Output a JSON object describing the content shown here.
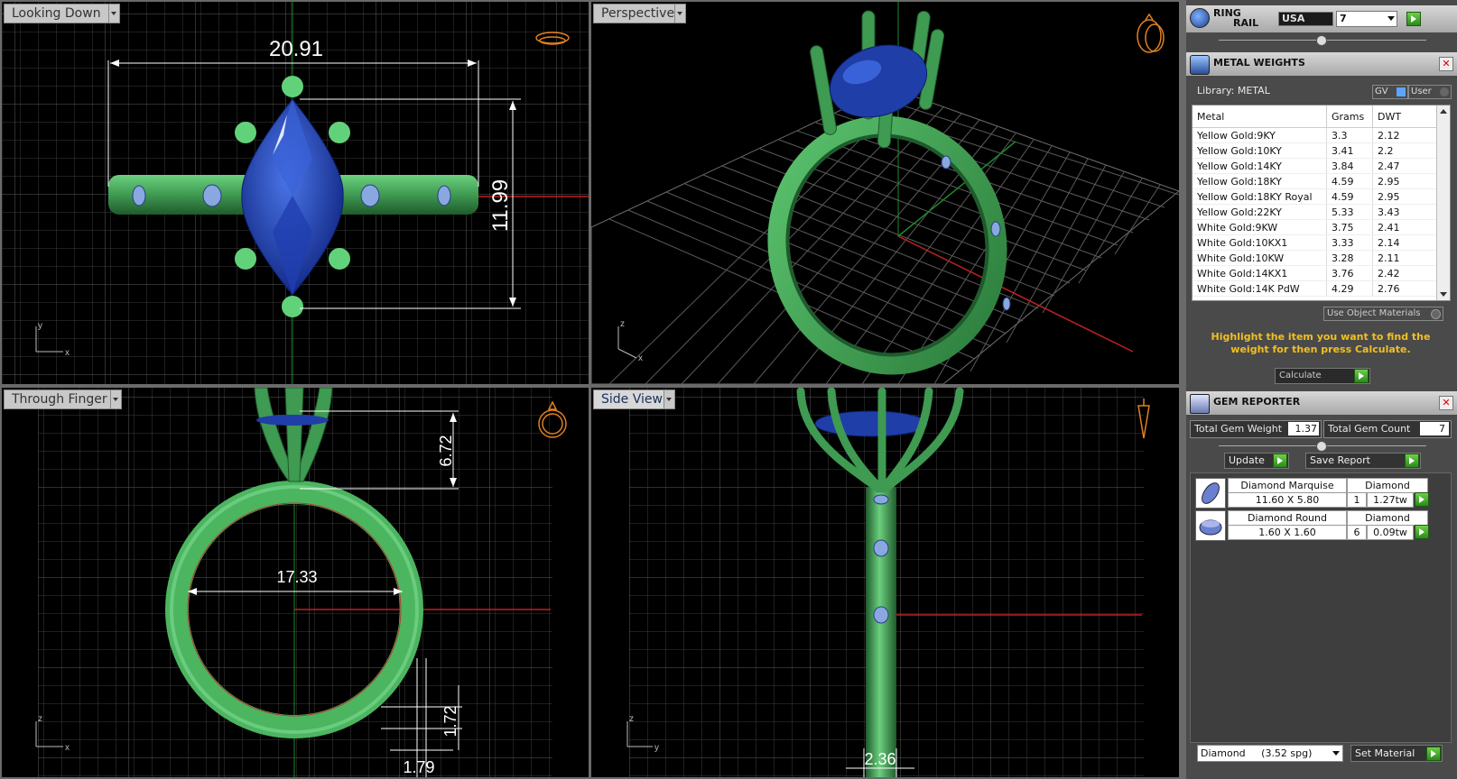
{
  "viewports": {
    "top": {
      "title": "Looking Down",
      "dim_width": "20.91",
      "dim_height": "11.99"
    },
    "perspective": {
      "title": "Perspective"
    },
    "front": {
      "title": "Through Finger",
      "dim_diameter": "17.33",
      "dim_prong_height": "6.72",
      "dim_band_thickness": "1.72",
      "dim_band_width": "1.79"
    },
    "side": {
      "title": "Side View",
      "dim_shank": "2.36"
    }
  },
  "ring_rail": {
    "title_line1": "RING",
    "title_line2": "RAIL",
    "size_system": "USA",
    "size_value": "7"
  },
  "metal_weights": {
    "title": "METAL WEIGHTS",
    "library_label": "Library: METAL",
    "gv_label": "GV",
    "user_label": "User",
    "columns": [
      "Metal",
      "Grams",
      "DWT"
    ],
    "rows": [
      [
        "Yellow Gold:9KY",
        "3.3",
        "2.12"
      ],
      [
        "Yellow Gold:10KY",
        "3.41",
        "2.2"
      ],
      [
        "Yellow Gold:14KY",
        "3.84",
        "2.47"
      ],
      [
        "Yellow Gold:18KY",
        "4.59",
        "2.95"
      ],
      [
        "Yellow Gold:18KY Royal",
        "4.59",
        "2.95"
      ],
      [
        "Yellow Gold:22KY",
        "5.33",
        "3.43"
      ],
      [
        "White Gold:9KW",
        "3.75",
        "2.41"
      ],
      [
        "White Gold:10KX1",
        "3.33",
        "2.14"
      ],
      [
        "White Gold:10KW",
        "3.28",
        "2.11"
      ],
      [
        "White Gold:14KX1",
        "3.76",
        "2.42"
      ],
      [
        "White Gold:14K PdW",
        "4.29",
        "2.76"
      ]
    ],
    "use_object_materials": "Use Object Materials",
    "hint": "Highlight the item you want to find the weight for then press Calculate.",
    "calculate_label": "Calculate"
  },
  "gem_reporter": {
    "title": "GEM REPORTER",
    "total_weight_label": "Total Gem Weight",
    "total_weight_value": "1.37",
    "total_count_label": "Total Gem Count",
    "total_count_value": "7",
    "update_label": "Update",
    "save_report_label": "Save Report",
    "gems": [
      {
        "name": "Diamond Marquise",
        "material": "Diamond",
        "size": "11.60 X 5.80",
        "count": "1",
        "weight": "1.27tw"
      },
      {
        "name": "Diamond Round",
        "material": "Diamond",
        "size": "1.60 X 1.60",
        "count": "6",
        "weight": "0.09tw"
      }
    ],
    "material_select": "Diamond     (3.52 spg)",
    "set_material_label": "Set Material"
  },
  "colors": {
    "metal_green": "#3f9a52",
    "gem_blue": "#1f3ea8",
    "grid": "#4a4a4a",
    "accent_yellow": "#f0c020",
    "button_green": "#3fae2a"
  }
}
